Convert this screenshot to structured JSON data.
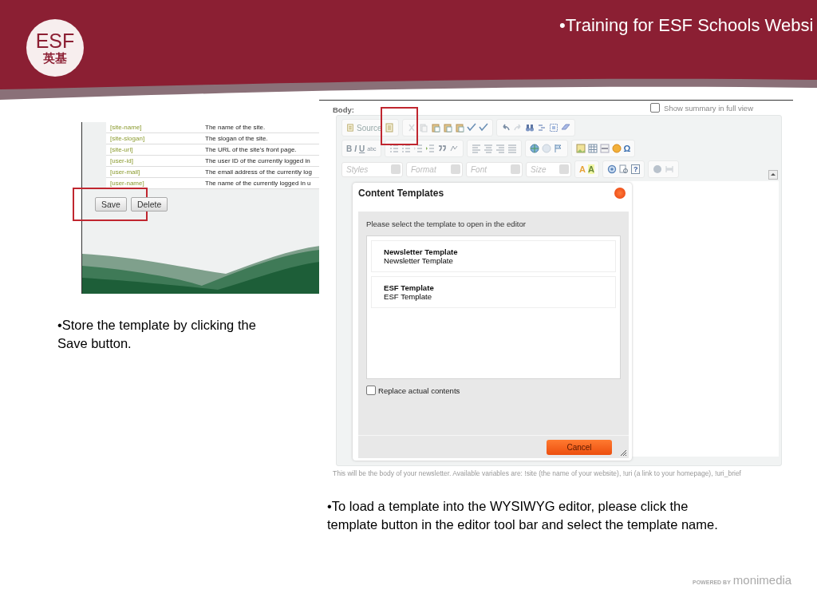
{
  "header": {
    "logo_latin": "ESF",
    "logo_chinese": "英基",
    "title": "•Training for ESF Schools Websi"
  },
  "left_screenshot": {
    "rows": [
      {
        "token": "[site-name]",
        "description": "The name of the site."
      },
      {
        "token": "[site-slogan]",
        "description": "The slogan of the site."
      },
      {
        "token": "[site-url]",
        "description": "The URL of the site's front page."
      },
      {
        "token": "[user-id]",
        "description": "The user ID of the currently logged in"
      },
      {
        "token": "[user-mail]",
        "description": "The email address of the currently log"
      },
      {
        "token": "[user-name]",
        "description": "The name of the currently logged in u"
      }
    ],
    "buttons": [
      "Save",
      "Delete"
    ]
  },
  "left_caption": "•Store the template by clicking the Save button.",
  "editor": {
    "label": "Body:",
    "summary_toggle": "Show summary in full view",
    "source_button": "Source",
    "format_buttons": [
      "B",
      "I",
      "U",
      "abc"
    ],
    "combos": [
      "Styles",
      "Format",
      "Font",
      "Size"
    ],
    "text_color": "A",
    "background_color": "A",
    "help": "?",
    "special_char": "Ω",
    "dialog": {
      "title": "Content Templates",
      "prompt": "Please select the template to open in the editor",
      "templates": [
        {
          "title": "Newsletter Template",
          "description": "Newsletter Template"
        },
        {
          "title": "ESF Template",
          "description": "ESF Template"
        }
      ],
      "replace_checkbox": {
        "label": "Replace actual contents",
        "checked": false
      },
      "cancel": "Cancel"
    },
    "hint": "This will be the body of your newsletter. Available variables are: !site (the name of your website), !uri (a link to your homepage), !uri_brief"
  },
  "bottom_caption": "•To load a template into the WYSIWYG editor, please click the template button in the editor tool bar and select the template name.",
  "footer": {
    "powered_by": "POWERED BY",
    "brand": "monimedia"
  }
}
